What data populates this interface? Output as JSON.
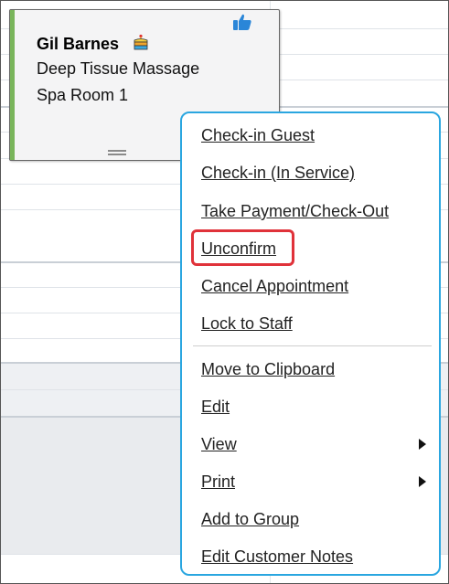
{
  "appointment": {
    "guest_name": "Gil Barnes",
    "service": "Deep Tissue Massage",
    "room": "Spa Room 1",
    "status_color": "#79b55b",
    "icons": [
      "cake-icon",
      "thumbs-up-icon",
      "drag-grip-icon"
    ]
  },
  "context_menu": {
    "border_color": "#2aa6e0",
    "items": [
      {
        "label": "Check-in Guest"
      },
      {
        "label": "Check-in (In Service)"
      },
      {
        "label": "Take Payment/Check-Out"
      },
      {
        "label": "Unconfirm",
        "highlighted": true
      },
      {
        "label": "Cancel Appointment"
      },
      {
        "label": "Lock to Staff"
      },
      {
        "label": "Move to Clipboard"
      },
      {
        "label": "Edit"
      },
      {
        "label": "View",
        "submenu": true
      },
      {
        "label": "Print",
        "submenu": true
      },
      {
        "label": "Add to Group"
      },
      {
        "label": "Edit Customer Notes"
      }
    ],
    "highlight_color": "#e0323a"
  }
}
